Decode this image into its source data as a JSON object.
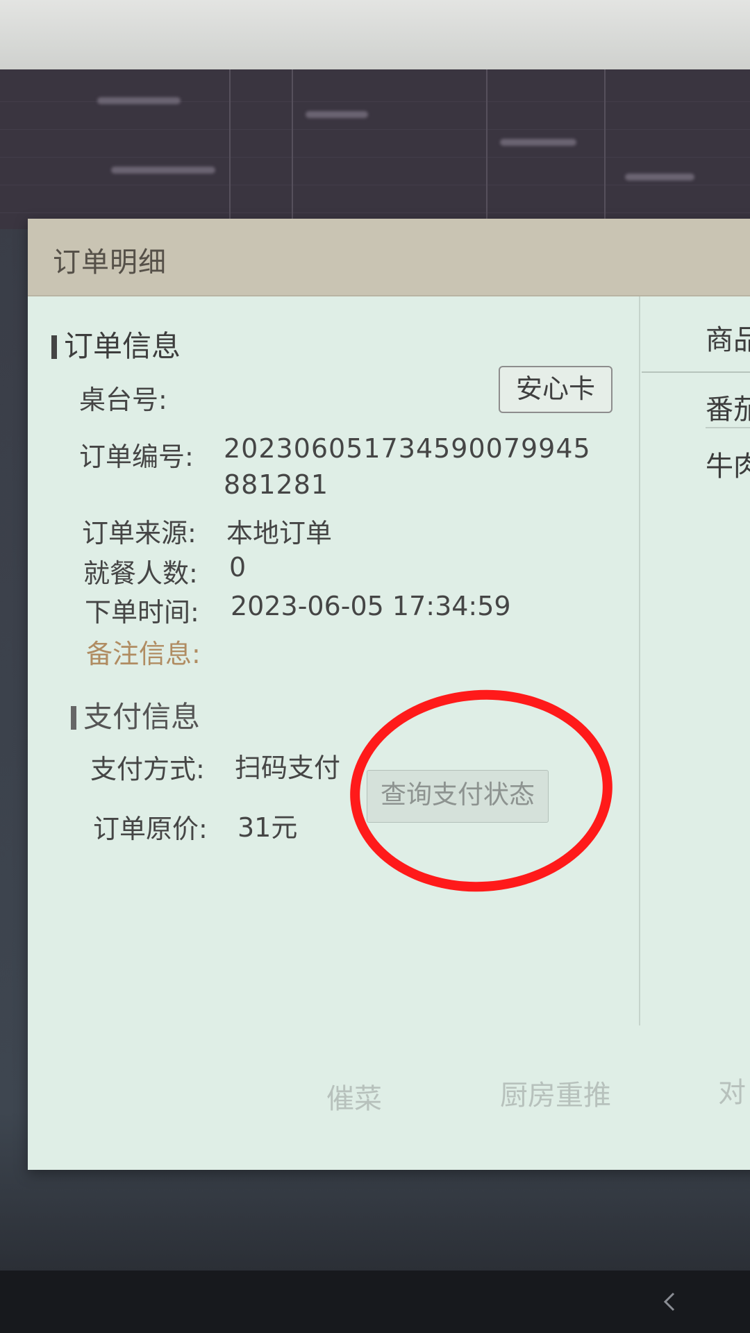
{
  "dialog": {
    "title": "订单明细"
  },
  "order_info": {
    "section_title": "订单信息",
    "table_label": "桌台号:",
    "anxin_card_button": "安心卡",
    "order_no_label": "订单编号:",
    "order_no_value": "202306051734590079945881281",
    "source_label": "订单来源:",
    "source_value": "本地订单",
    "diners_label": "就餐人数:",
    "diners_value": "0",
    "time_label": "下单时间:",
    "time_value": "2023-06-05 17:34:59",
    "note_label": "备注信息:"
  },
  "payment_info": {
    "section_title": "支付信息",
    "method_label": "支付方式:",
    "method_value": "扫码支付",
    "query_button": "查询支付状态",
    "price_label": "订单原价:",
    "price_value": "31元"
  },
  "goods": {
    "header": "商品名",
    "items": [
      "番茄鸡",
      "牛肉炒"
    ]
  },
  "footer": {
    "urge_button": "催菜",
    "kitchen_reprint_button": "厨房重推",
    "partial_button": "对"
  },
  "colors": {
    "dialog_bg": "#dfeee6",
    "header_bg": "#c9c4b3",
    "annotation_red": "#ff1a1a",
    "note_label": "#b08c62"
  }
}
